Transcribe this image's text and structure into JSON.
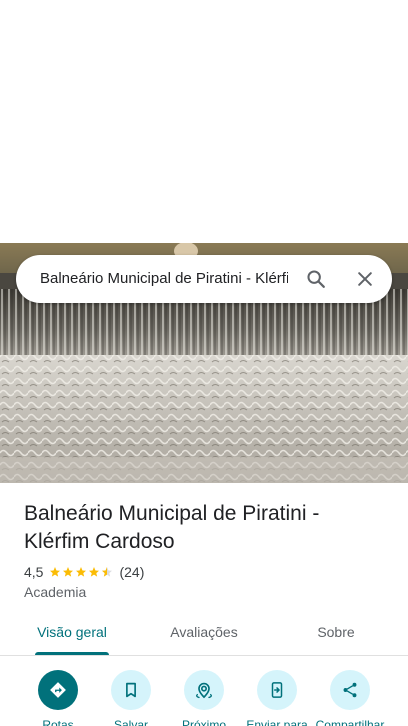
{
  "search": {
    "query": "Balneário Municipal de Piratini - Klérfim Cardoso"
  },
  "place": {
    "name": "Balneário Municipal de Piratini - Klérfim Cardoso",
    "rating": "4,5",
    "stars": 4.5,
    "review_count": "(24)",
    "category": "Academia"
  },
  "tabs": [
    {
      "label": "Visão geral",
      "active": true
    },
    {
      "label": "Avaliações",
      "active": false
    },
    {
      "label": "Sobre",
      "active": false
    }
  ],
  "actions": [
    {
      "label": "Rotas",
      "icon": "directions-icon",
      "primary": true
    },
    {
      "label": "Salvar",
      "icon": "bookmark-icon",
      "primary": false
    },
    {
      "label": "Próximo",
      "icon": "nearby-icon",
      "primary": false
    },
    {
      "label": "Enviar para",
      "icon": "send-to-phone-icon",
      "primary": false
    },
    {
      "label": "Compartilhar",
      "icon": "share-icon",
      "primary": false
    }
  ],
  "colors": {
    "accent": "#01717b",
    "action_bg": "#d5f4fb",
    "star": "#fbbc04"
  }
}
